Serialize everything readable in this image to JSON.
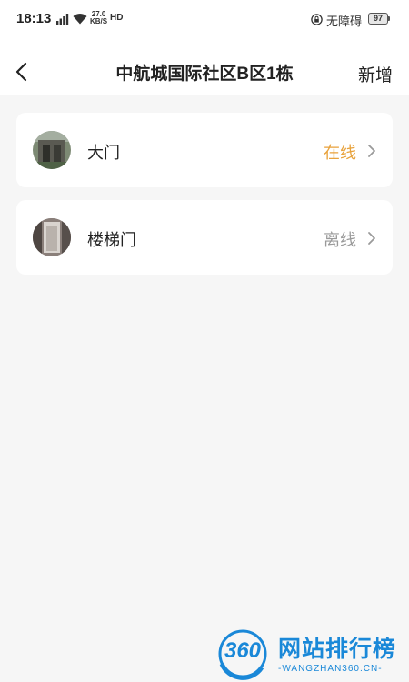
{
  "status_bar": {
    "time": "18:13",
    "net_speed_value": "27.0",
    "net_speed_unit": "KB/S",
    "hd_label": "HD",
    "accessibility": "无障碍",
    "battery": "97"
  },
  "nav": {
    "title": "中航城国际社区B区1栋",
    "add_label": "新增"
  },
  "devices": [
    {
      "name": "大门",
      "status": "在线",
      "status_color": "#e8a23c"
    },
    {
      "name": "楼梯门",
      "status": "离线",
      "status_color": "#9a9a9a"
    }
  ],
  "watermark": {
    "logo": "360",
    "text": "网站排行榜",
    "sub": "-WANGZHAN360.CN-"
  }
}
